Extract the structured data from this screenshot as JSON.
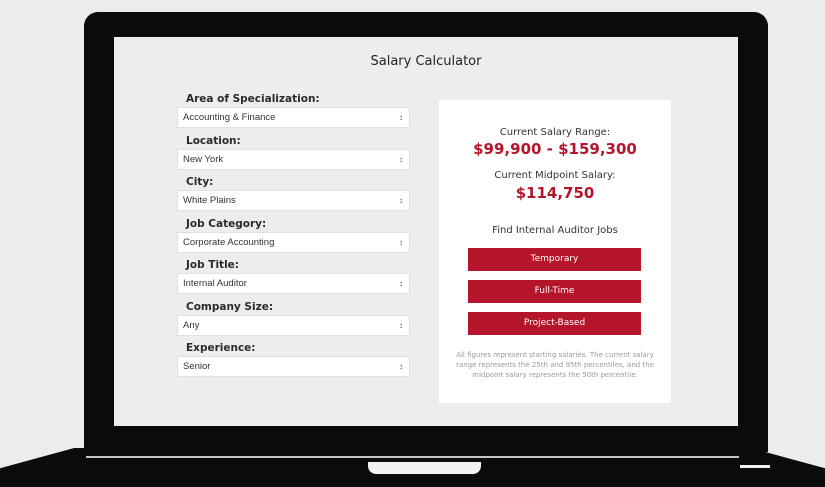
{
  "title": "Salary Calculator",
  "fields": [
    {
      "label": "Area of Specialization:",
      "value": "Accounting & Finance"
    },
    {
      "label": "Location:",
      "value": "New York"
    },
    {
      "label": "City:",
      "value": "White Plains"
    },
    {
      "label": "Job Category:",
      "value": "Corporate Accounting"
    },
    {
      "label": "Job Title:",
      "value": "Internal Auditor"
    },
    {
      "label": "Company Size:",
      "value": "Any"
    },
    {
      "label": "Experience:",
      "value": "Senior"
    }
  ],
  "select_arrow_glyph": "↕",
  "result": {
    "range_label": "Current Salary Range:",
    "range_value": "$99,900 - $159,300",
    "midpoint_label": "Current Midpoint Salary:",
    "midpoint_value": "$114,750",
    "jobs_heading": "Find Internal Auditor Jobs",
    "buttons": [
      "Temporary",
      "Full-Time",
      "Project-Based"
    ],
    "note": "All figures represent starting salaries. The current salary range represents the 25th and 95th percentiles, and the midpoint salary represents the 50th percentile."
  },
  "colors": {
    "accent": "#b5152b",
    "bezel": "#0b0b0b",
    "screen_bg": "#ededed"
  }
}
